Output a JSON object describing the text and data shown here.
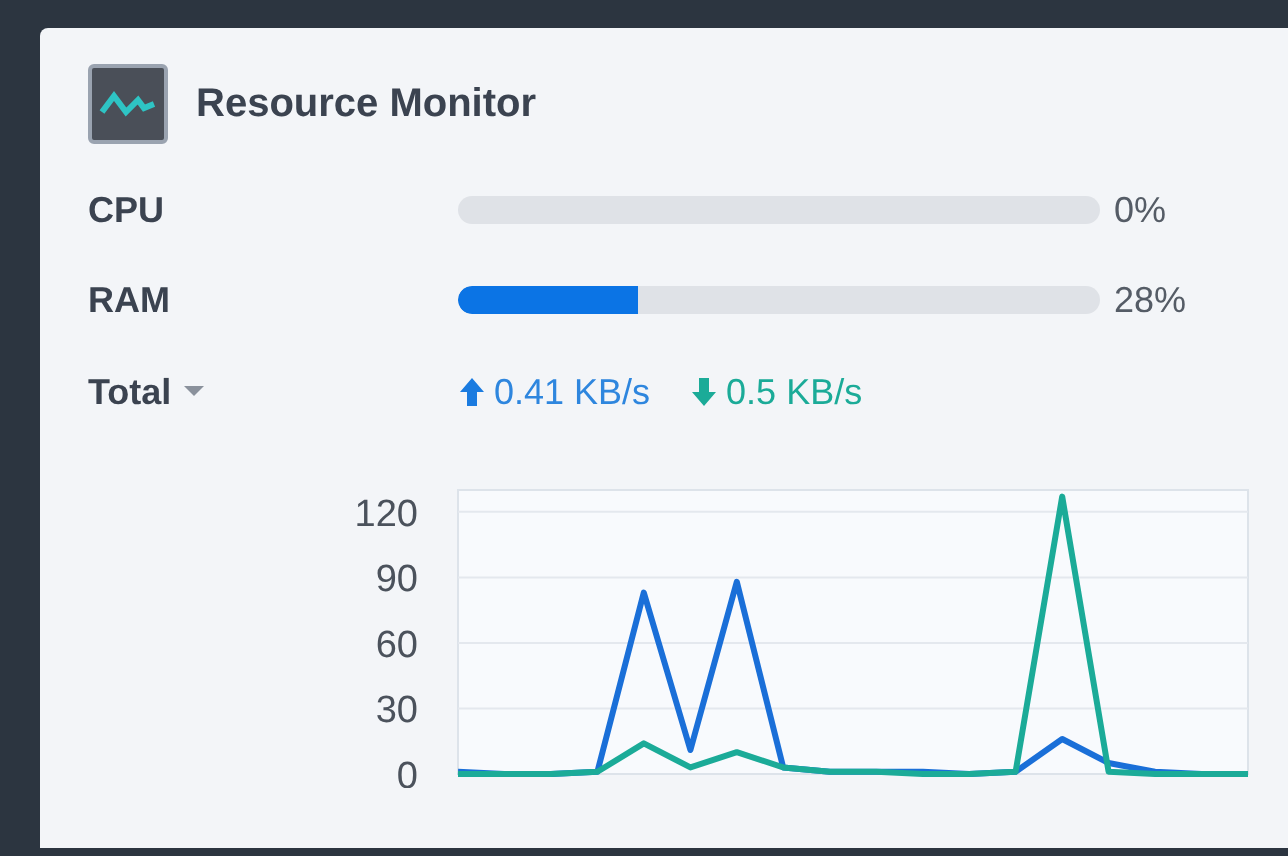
{
  "widget": {
    "title": "Resource Monitor"
  },
  "meters": [
    {
      "label": "CPU",
      "level": 0,
      "reading": "0%"
    },
    {
      "label": "RAM",
      "level": 0.28,
      "reading": "28%"
    }
  ],
  "network": {
    "selector": "Total",
    "upload": "0.41 KB/s",
    "download": "0.5 KB/s"
  },
  "chart_data": {
    "type": "line",
    "grid": true,
    "ylim": [
      0,
      130
    ],
    "yticks": [
      0,
      30,
      60,
      90,
      120
    ],
    "series": [
      {
        "color": "#1a6fd8",
        "values": [
          1,
          0,
          0,
          1,
          83,
          11,
          88,
          3,
          1,
          1,
          1,
          0,
          1,
          16,
          5,
          1,
          0,
          0
        ]
      },
      {
        "color": "#1bab98",
        "values": [
          0,
          0,
          0,
          1,
          14,
          3,
          10,
          3,
          1,
          1,
          0,
          0,
          1,
          127,
          1,
          0,
          0,
          0
        ]
      }
    ]
  }
}
